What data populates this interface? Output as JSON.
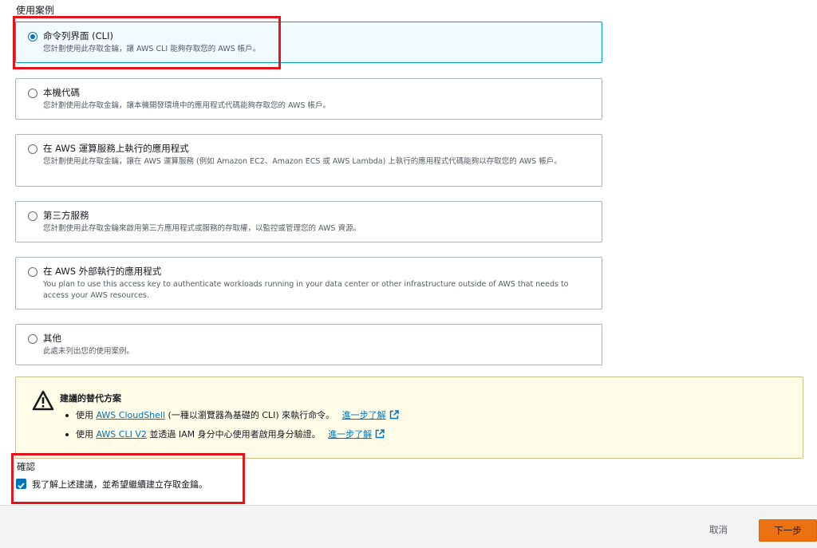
{
  "section_label": "使用案例",
  "options": [
    {
      "title": "命令列界面 (CLI)",
      "description": "您計劃使用此存取金鑰，讓 AWS CLI 能夠存取您的 AWS 帳戶。",
      "selected": true
    },
    {
      "title": "本機代碼",
      "description": "您計劃使用此存取金鑰，讓本機開發環境中的應用程式代碼能夠存取您的 AWS 帳戶。",
      "selected": false
    },
    {
      "title": "在 AWS 運算服務上執行的應用程式",
      "description": "您計劃使用此存取金鑰，讓在 AWS 運算服務 (例如 Amazon EC2、Amazon ECS 或 AWS Lambda) 上執行的應用程式代碼能夠以存取您的 AWS 帳戶。",
      "selected": false
    },
    {
      "title": "第三方服務",
      "description": "您計劃使用此存取金鑰來啟用第三方應用程式或服務的存取權，以監控或管理您的 AWS 資源。",
      "selected": false
    },
    {
      "title": "在 AWS 外部執行的應用程式",
      "description": "You plan to use this access key to authenticate workloads running in your data center or other infrastructure outside of AWS that needs to access your AWS resources.",
      "selected": false
    },
    {
      "title": "其他",
      "description": "此處未列出您的使用案例。",
      "selected": false
    }
  ],
  "alert": {
    "title": "建議的替代方案",
    "items": [
      {
        "prefix": "使用 ",
        "link": "AWS CloudShell",
        "suffix": " (一種以瀏覽器為基礎的 CLI) 來執行命令。",
        "learn_more": "進一步了解"
      },
      {
        "prefix": "使用 ",
        "link": "AWS CLI V2",
        "suffix": " 並透過 IAM 身分中心使用者啟用身分驗證。",
        "learn_more": "進一步了解"
      }
    ]
  },
  "confirmation": {
    "label": "確認",
    "checkbox_label": "我了解上述建議，並希望繼續建立存取金鑰。",
    "checked": true
  },
  "footer": {
    "cancel": "取消",
    "next": "下一步"
  },
  "colors": {
    "primary_button": "#ec7211",
    "link": "#0073bb",
    "highlight_box": "#e3141a",
    "alert_bg": "#fffce8"
  }
}
